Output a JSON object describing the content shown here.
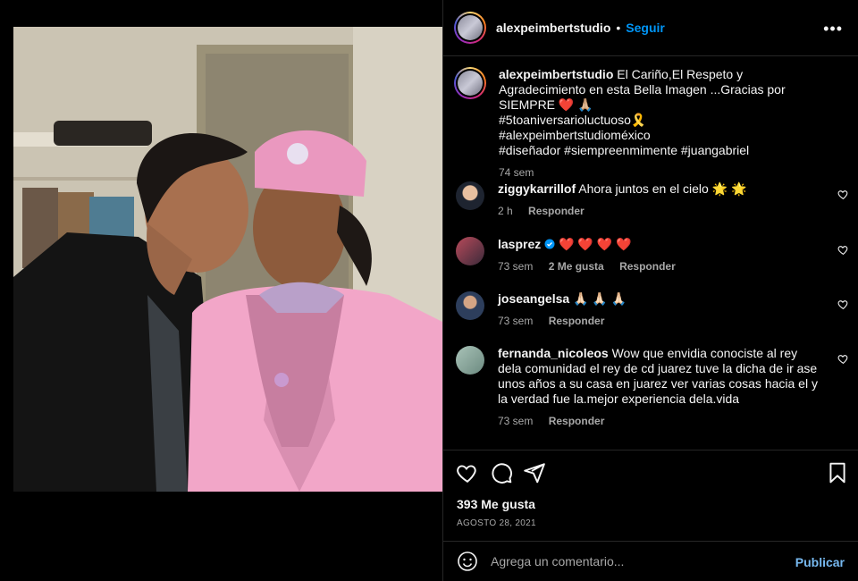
{
  "post": {
    "username": "alexpeimbertstudio",
    "separator": "•",
    "follow_label": "Seguir",
    "more_label": "•••"
  },
  "caption": {
    "username": "alexpeimbertstudio",
    "text": "El Cariño,El Respeto y Agradecimiento en esta Bella Imagen ...Gracias por SIEMPRE ❤️ 🙏🏼",
    "tags": [
      "#5toaniversarioluctuoso🎗️",
      "#alexpeimbertstudioméxico",
      "#diseñador #siempreenmimente #juangabriel"
    ],
    "time": "74 sem"
  },
  "comments": [
    {
      "username": "ziggykarrillof",
      "text": "Ahora juntos en el cielo 🌟 🌟",
      "time": "2 h",
      "likes": "",
      "reply": "Responder",
      "avatar_color": "#2a2f3a",
      "verified": false
    },
    {
      "username": "lasprez",
      "text": "❤️ ❤️ ❤️ ❤️",
      "time": "73 sem",
      "likes": "2 Me gusta",
      "reply": "Responder",
      "avatar_color": "#6f3a44",
      "verified": true
    },
    {
      "username": "joseangelsa",
      "text": "🙏🏻 🙏🏻 🙏🏻",
      "time": "73 sem",
      "likes": "",
      "reply": "Responder",
      "avatar_color": "#5a6170",
      "verified": false
    },
    {
      "username": "fernanda_nicoleos",
      "text": "Wow que envidia conociste al rey dela comunidad el rey de cd juarez tuve la dicha de ir ase unos años a su casa en juarez ver varias cosas hacia el y la verdad fue la.mejor experiencia dela.vida",
      "time": "73 sem",
      "likes": "",
      "reply": "Responder",
      "avatar_color": "#8aa39a",
      "verified": false
    }
  ],
  "footer": {
    "likes": "393 Me gusta",
    "date": "AGOSTO 28, 2021",
    "comment_placeholder": "Agrega un comentario...",
    "publish_label": "Publicar"
  },
  "colors": {
    "accent": "#0095f6",
    "background": "#000000",
    "muted": "#a8a8a8",
    "heart": "#ff3040",
    "suit_pink": "#f2a6c8"
  },
  "icons": [
    "heart-icon",
    "comment-icon",
    "share-icon",
    "bookmark-icon",
    "smile-icon",
    "more-icon",
    "verified-icon"
  ]
}
